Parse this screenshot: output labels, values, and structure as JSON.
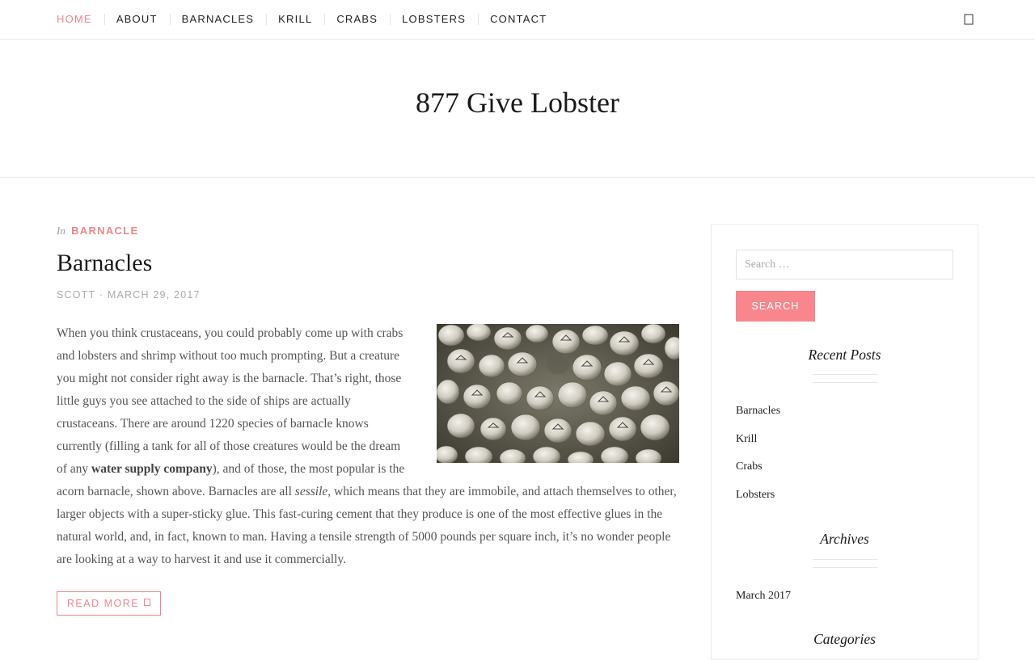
{
  "nav": {
    "items": [
      {
        "label": "HOME",
        "active": true
      },
      {
        "label": "ABOUT",
        "active": false
      },
      {
        "label": "BARNACLES",
        "active": false
      },
      {
        "label": "KRILL",
        "active": false
      },
      {
        "label": "CRABS",
        "active": false
      },
      {
        "label": "LOBSTERS",
        "active": false
      },
      {
        "label": "CONTACT",
        "active": false
      }
    ],
    "search_icon": "search-icon"
  },
  "header": {
    "site_title": "877 Give Lobster"
  },
  "post": {
    "category_prefix": "In",
    "category": "BARNACLE",
    "title": "Barnacles",
    "author": "SCOTT",
    "separator": "·",
    "date": "MARCH 29, 2017",
    "image_alt": "barnacles photo",
    "body": {
      "part1": "When you think crustaceans, you could probably come up with crabs and lobsters and shrimp without too much prompting. But a creature you might not consider right away is the barnacle. That’s right, those little guys you see attached to the side of ships are actually crustaceans. There are around 1220 species of barnacle knows currently (filling a tank for all of those creatures would be the dream of any ",
      "link_text": "water supply company",
      "part2": "), and of those, the most popular is the acorn barnacle, shown above. Barnacles are all ",
      "emphasis": "sessile",
      "part3": ", which means that they are immobile, and attach themselves to other, larger objects with a super-sticky glue. This fast-curing cement that they produce is one of the most effective glues in the natural world, and, in fact, known to man. Having a tensile strength of 5000 pounds per square inch, it’s no wonder people are looking at a way to harvest it and use it commercially."
    },
    "read_more": "READ MORE",
    "read_more_icon": "arrow-right-icon"
  },
  "sidebar": {
    "search": {
      "placeholder": "Search …",
      "value": "",
      "button": "SEARCH"
    },
    "recent_posts": {
      "title": "Recent Posts",
      "items": [
        "Barnacles",
        "Krill",
        "Crabs",
        "Lobsters"
      ]
    },
    "archives": {
      "title": "Archives",
      "items": [
        "March 2017"
      ]
    },
    "categories": {
      "title": "Categories"
    }
  },
  "colors": {
    "accent": "#f0858a",
    "button_bg": "#f8868c",
    "text": "#555555",
    "heading": "#1a1a1a",
    "border": "#e8e8e8"
  }
}
